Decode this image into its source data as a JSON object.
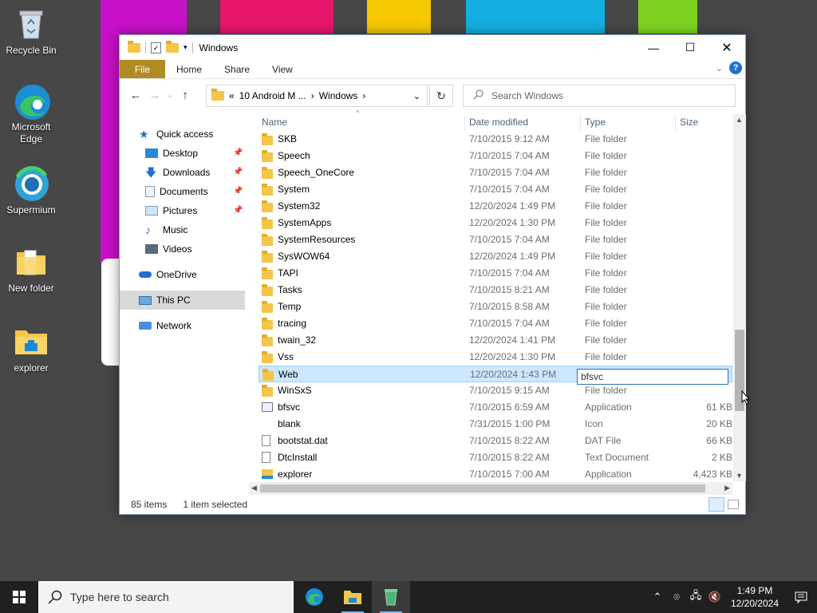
{
  "wallpaper": {
    "stripes": [
      {
        "color": "#c810c8"
      },
      {
        "color": "#e8166a"
      },
      {
        "color": "#f6c800"
      },
      {
        "color": "#14aee0"
      },
      {
        "color": "#7ed321"
      }
    ]
  },
  "desktop": {
    "icons": [
      {
        "label": "Recycle Bin",
        "icon": "recycle-bin-icon"
      },
      {
        "label": "Microsoft Edge",
        "icon": "edge-icon"
      },
      {
        "label": "Supermium",
        "icon": "supermium-icon"
      },
      {
        "label": "New folder",
        "icon": "folder-icon"
      },
      {
        "label": "explorer",
        "icon": "explorer-icon"
      }
    ]
  },
  "window": {
    "title": "Windows",
    "controls": {
      "minimize": "—",
      "maximize": "☐",
      "close": "✕"
    },
    "ribbon": {
      "tabs": [
        "File",
        "Home",
        "Share",
        "View"
      ],
      "file_color": "#b08a23"
    },
    "address": {
      "prefix": "«",
      "segments": [
        "10 Android M ...",
        "Windows"
      ]
    },
    "search": {
      "placeholder": "Search Windows"
    },
    "nav": {
      "quick_access": "Quick access",
      "items": [
        {
          "label": "Desktop",
          "pinned": true
        },
        {
          "label": "Downloads",
          "pinned": true
        },
        {
          "label": "Documents",
          "pinned": true
        },
        {
          "label": "Pictures",
          "pinned": true
        },
        {
          "label": "Music",
          "pinned": false
        },
        {
          "label": "Videos",
          "pinned": false
        }
      ],
      "onedrive": "OneDrive",
      "thispc": "This PC",
      "network": "Network"
    },
    "columns": {
      "name": "Name",
      "date": "Date modified",
      "type": "Type",
      "size": "Size"
    },
    "files": [
      {
        "name": "SKB",
        "date": "7/10/2015 9:12 AM",
        "type": "File folder",
        "size": "",
        "kind": "folder"
      },
      {
        "name": "Speech",
        "date": "7/10/2015 7:04 AM",
        "type": "File folder",
        "size": "",
        "kind": "folder"
      },
      {
        "name": "Speech_OneCore",
        "date": "7/10/2015 7:04 AM",
        "type": "File folder",
        "size": "",
        "kind": "folder"
      },
      {
        "name": "System",
        "date": "7/10/2015 7:04 AM",
        "type": "File folder",
        "size": "",
        "kind": "folder"
      },
      {
        "name": "System32",
        "date": "12/20/2024 1:49 PM",
        "type": "File folder",
        "size": "",
        "kind": "folder"
      },
      {
        "name": "SystemApps",
        "date": "12/20/2024 1:30 PM",
        "type": "File folder",
        "size": "",
        "kind": "folder"
      },
      {
        "name": "SystemResources",
        "date": "7/10/2015 7:04 AM",
        "type": "File folder",
        "size": "",
        "kind": "folder"
      },
      {
        "name": "SysWOW64",
        "date": "12/20/2024 1:49 PM",
        "type": "File folder",
        "size": "",
        "kind": "folder"
      },
      {
        "name": "TAPI",
        "date": "7/10/2015 7:04 AM",
        "type": "File folder",
        "size": "",
        "kind": "folder"
      },
      {
        "name": "Tasks",
        "date": "7/10/2015 8:21 AM",
        "type": "File folder",
        "size": "",
        "kind": "folder"
      },
      {
        "name": "Temp",
        "date": "7/10/2015 8:58 AM",
        "type": "File folder",
        "size": "",
        "kind": "folder"
      },
      {
        "name": "tracing",
        "date": "7/10/2015 7:04 AM",
        "type": "File folder",
        "size": "",
        "kind": "folder"
      },
      {
        "name": "twain_32",
        "date": "12/20/2024 1:41 PM",
        "type": "File folder",
        "size": "",
        "kind": "folder"
      },
      {
        "name": "Vss",
        "date": "12/20/2024 1:30 PM",
        "type": "File folder",
        "size": "",
        "kind": "folder"
      },
      {
        "name": "Web",
        "date": "12/20/2024 1:43 PM",
        "type": "",
        "size": "",
        "kind": "folder",
        "selected": true,
        "rename_value": "bfsvc"
      },
      {
        "name": "WinSxS",
        "date": "7/10/2015 9:15 AM",
        "type": "File folder",
        "size": "",
        "kind": "folder"
      },
      {
        "name": "bfsvc",
        "date": "7/10/2015 6:59 AM",
        "type": "Application",
        "size": "61 KB",
        "kind": "app"
      },
      {
        "name": "blank",
        "date": "7/31/2015 1:00 PM",
        "type": "Icon",
        "size": "20 KB",
        "kind": "blank"
      },
      {
        "name": "bootstat.dat",
        "date": "7/10/2015 8:22 AM",
        "type": "DAT File",
        "size": "66 KB",
        "kind": "file"
      },
      {
        "name": "DtcInstall",
        "date": "7/10/2015 8:22 AM",
        "type": "Text Document",
        "size": "2 KB",
        "kind": "file"
      },
      {
        "name": "explorer",
        "date": "7/10/2015 7:00 AM",
        "type": "Application",
        "size": "4,423 KB",
        "kind": "explorer"
      }
    ],
    "status": {
      "count": "85 items",
      "selection": "1 item selected"
    }
  },
  "taskbar": {
    "search_placeholder": "Type here to search",
    "time": "1:49 PM",
    "date": "12/20/2024"
  }
}
